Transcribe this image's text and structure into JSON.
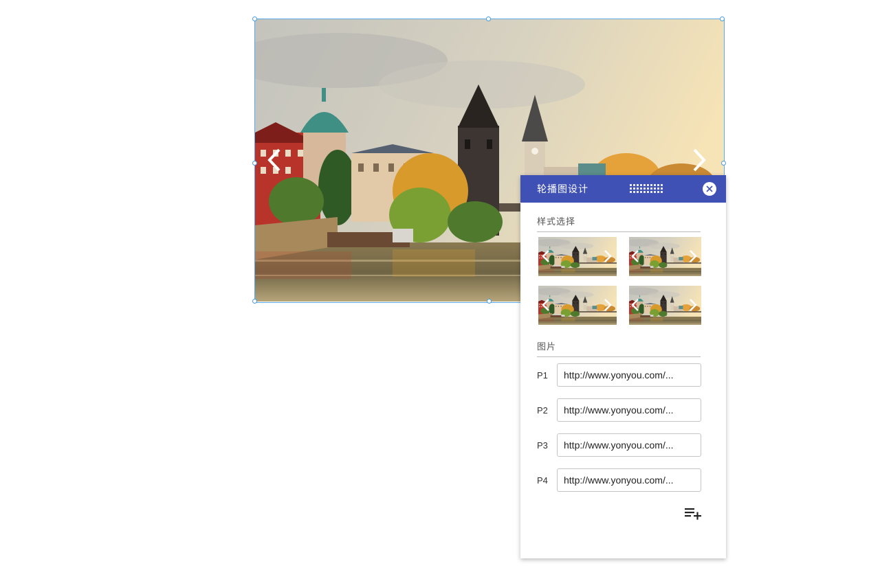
{
  "panel": {
    "title": "轮播图设计",
    "style_section_title": "样式选择",
    "images_section_title": "图片",
    "styles": [
      {
        "name": "style-1"
      },
      {
        "name": "style-2"
      },
      {
        "name": "style-3"
      },
      {
        "name": "style-4"
      }
    ],
    "pictures": [
      {
        "label": "P1",
        "url": "http://www.yonyou.com/..."
      },
      {
        "label": "P2",
        "url": "http://www.yonyou.com/..."
      },
      {
        "label": "P3",
        "url": "http://www.yonyou.com/..."
      },
      {
        "label": "P4",
        "url": "http://www.yonyou.com/..."
      }
    ],
    "icons": {
      "close": "close-icon",
      "drag": "drag-grip-icon",
      "add": "playlist-add-icon"
    }
  },
  "carousel": {
    "icons": {
      "prev": "chevron-left-icon",
      "next": "chevron-right-icon"
    }
  },
  "colors": {
    "header": "#3f51b5",
    "selection": "#5aa9e6"
  }
}
